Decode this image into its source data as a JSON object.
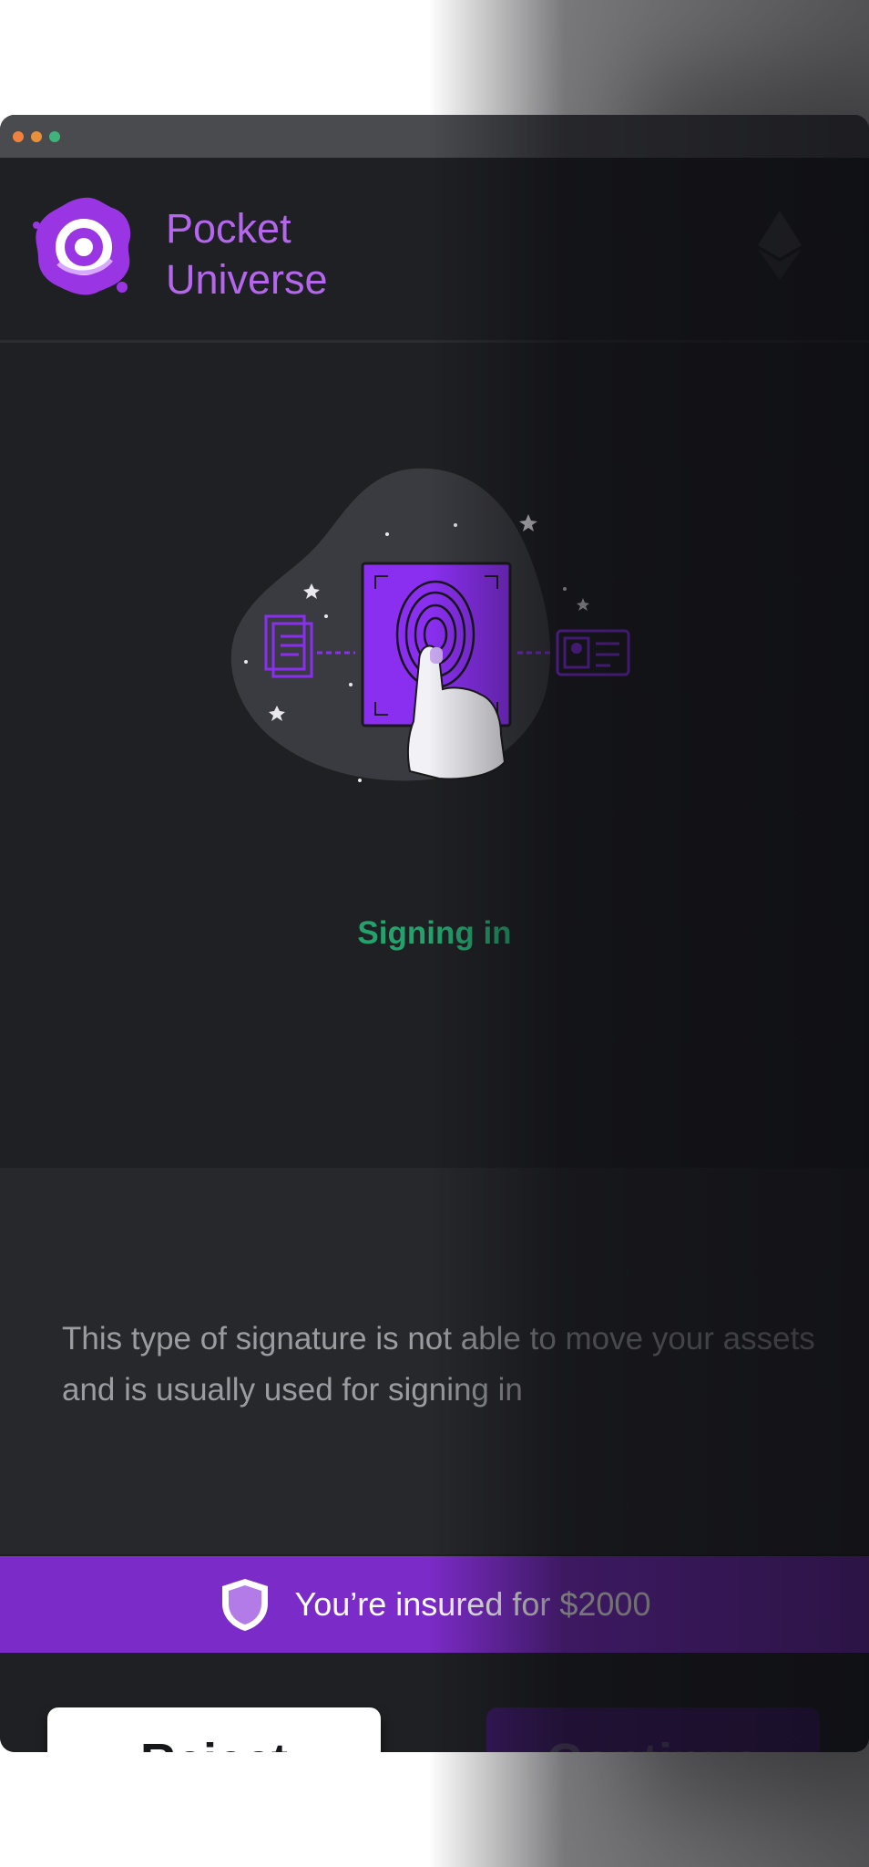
{
  "window": {
    "traffic_lights": [
      "#f0823f",
      "#e8913a",
      "#3eb37a"
    ]
  },
  "header": {
    "brand_line1": "Pocket",
    "brand_line2": "Universe",
    "logo_icon": "pocket-universe-logo",
    "network_icon": "ethereum-icon"
  },
  "hero": {
    "illustration": "fingerprint-signing-illustration",
    "status_text": "Signing in",
    "status_color": "#23a36c"
  },
  "info": {
    "description": "This type of signature is not able to move your assets and is usually used for signing in"
  },
  "insurance": {
    "text": "You’re insured for $2000",
    "icon": "shield-icon",
    "color": "#7b2bc7"
  },
  "actions": {
    "reject_label": "Reject",
    "continue_label": "Continue"
  }
}
